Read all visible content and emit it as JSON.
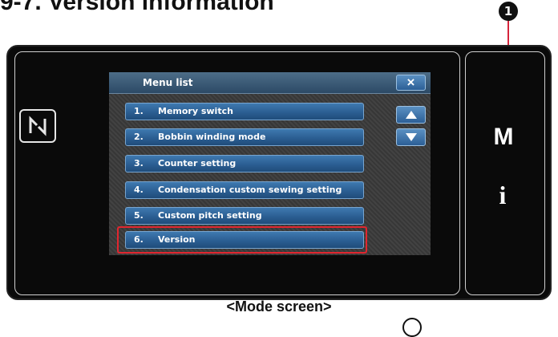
{
  "heading": "9-7. Version information",
  "callout_marker": "1",
  "device": {
    "m_key_label": "M",
    "info_key_label": "i"
  },
  "menu": {
    "title": "Menu list",
    "close_label": "×",
    "items": [
      {
        "num": "1.",
        "label": "Memory switch"
      },
      {
        "num": "2.",
        "label": "Bobbin winding mode"
      },
      {
        "num": "3.",
        "label": "Counter setting"
      },
      {
        "num": "4.",
        "label": "Condensation custom sewing setting"
      },
      {
        "num": "5.",
        "label": "Custom pitch setting"
      },
      {
        "num": "6.",
        "label": "Version"
      }
    ],
    "highlighted_item": "6. Version"
  },
  "caption": "<Mode screen>",
  "colors": {
    "button_blue": "#2b5e92",
    "highlight_red": "#e0262f",
    "callout_red": "#d6243b"
  },
  "icons": [
    "nfc-icon",
    "close-icon",
    "scroll-up-icon",
    "scroll-down-icon"
  ]
}
